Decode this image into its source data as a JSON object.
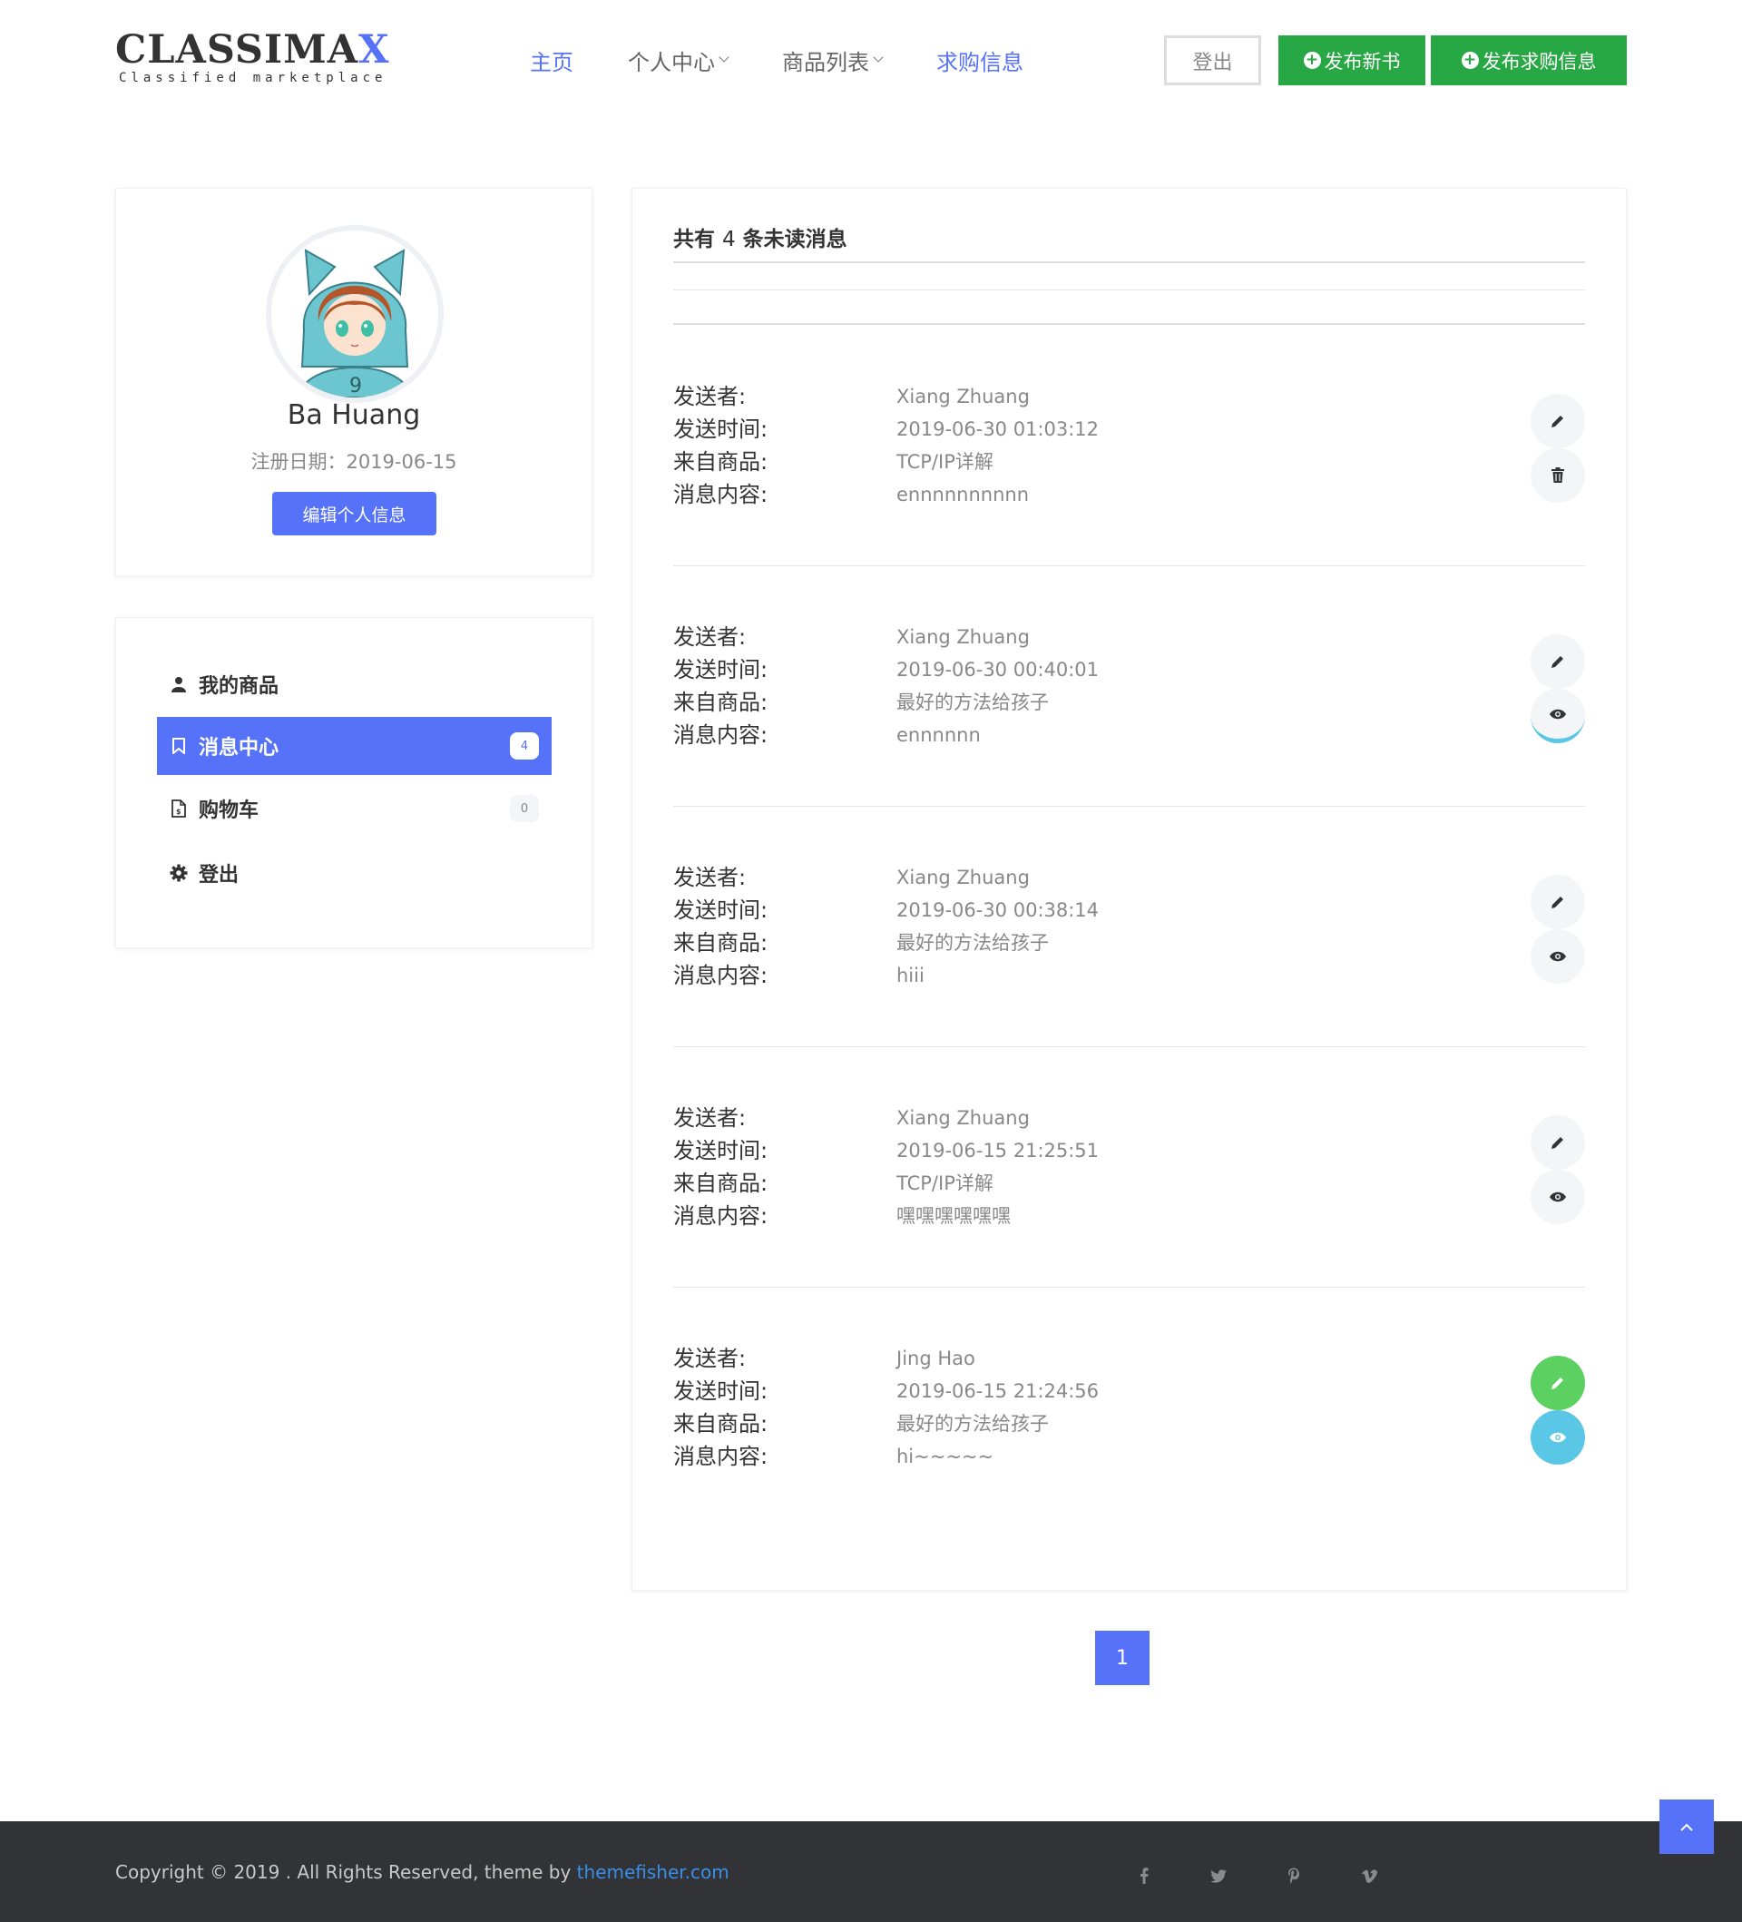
{
  "header": {
    "logo_text": "CLASSIMA",
    "logo_x": "X",
    "logo_tagline": "Classified marketplace",
    "nav": [
      {
        "label": "主页",
        "active": true
      },
      {
        "label": "个人中心",
        "dropdown": true
      },
      {
        "label": "商品列表",
        "dropdown": true
      },
      {
        "label": "求购信息",
        "active": true
      }
    ],
    "logout_label": "登出",
    "publish_book_label": "发布新书",
    "publish_request_label": "发布求购信息"
  },
  "profile": {
    "name": "Ba Huang",
    "register_date": "注册日期：2019-06-15",
    "edit_label": "编辑个人信息"
  },
  "sidebar": {
    "items": [
      {
        "label": "我的商品",
        "icon": "user-icon"
      },
      {
        "label": "消息中心",
        "icon": "bookmark-icon",
        "badge": "4",
        "active": true
      },
      {
        "label": "购物车",
        "icon": "file-icon",
        "badge": "0"
      },
      {
        "label": "登出",
        "icon": "gear-icon"
      }
    ]
  },
  "messages": {
    "title_prefix": "共有",
    "unread_count": "4",
    "title_suffix": "条未读消息",
    "labels": {
      "sender": "发送者:",
      "time": "发送时间:",
      "product": "来自商品:",
      "content": "消息内容:"
    },
    "items": [
      {
        "sender": "Xiang Zhuang",
        "time": "2019-06-30 01:03:12",
        "product": "TCP/IP详解",
        "content": "ennnnnnnnnn",
        "second_action": "delete-icon",
        "highlight": false
      },
      {
        "sender": "Xiang Zhuang",
        "time": "2019-06-30 00:40:01",
        "product": "最好的方法给孩子",
        "content": "ennnnnn",
        "second_action": "eye-icon",
        "highlight": false
      },
      {
        "sender": "Xiang Zhuang",
        "time": "2019-06-30 00:38:14",
        "product": "最好的方法给孩子",
        "content": "hiii",
        "second_action": "eye-icon",
        "highlight": false
      },
      {
        "sender": "Xiang Zhuang",
        "time": "2019-06-15 21:25:51",
        "product": "TCP/IP详解",
        "content": "嘿嘿嘿嘿嘿嘿",
        "second_action": "eye-icon",
        "highlight": false
      },
      {
        "sender": "Jing Hao",
        "time": "2019-06-15 21:24:56",
        "product": "最好的方法给孩子",
        "content": "hi~~~~~",
        "second_action": "eye-icon",
        "highlight": true
      }
    ]
  },
  "pagination": {
    "current": "1"
  },
  "footer": {
    "copyright": "Copyright © 2019 . All Rights Reserved, theme by ",
    "link": "themefisher.com",
    "social": [
      "facebook-icon",
      "twitter-icon",
      "pinterest-icon",
      "vimeo-icon"
    ]
  },
  "colors": {
    "accent": "#5672f9",
    "green": "#28a745",
    "footer_bg": "#323337"
  }
}
